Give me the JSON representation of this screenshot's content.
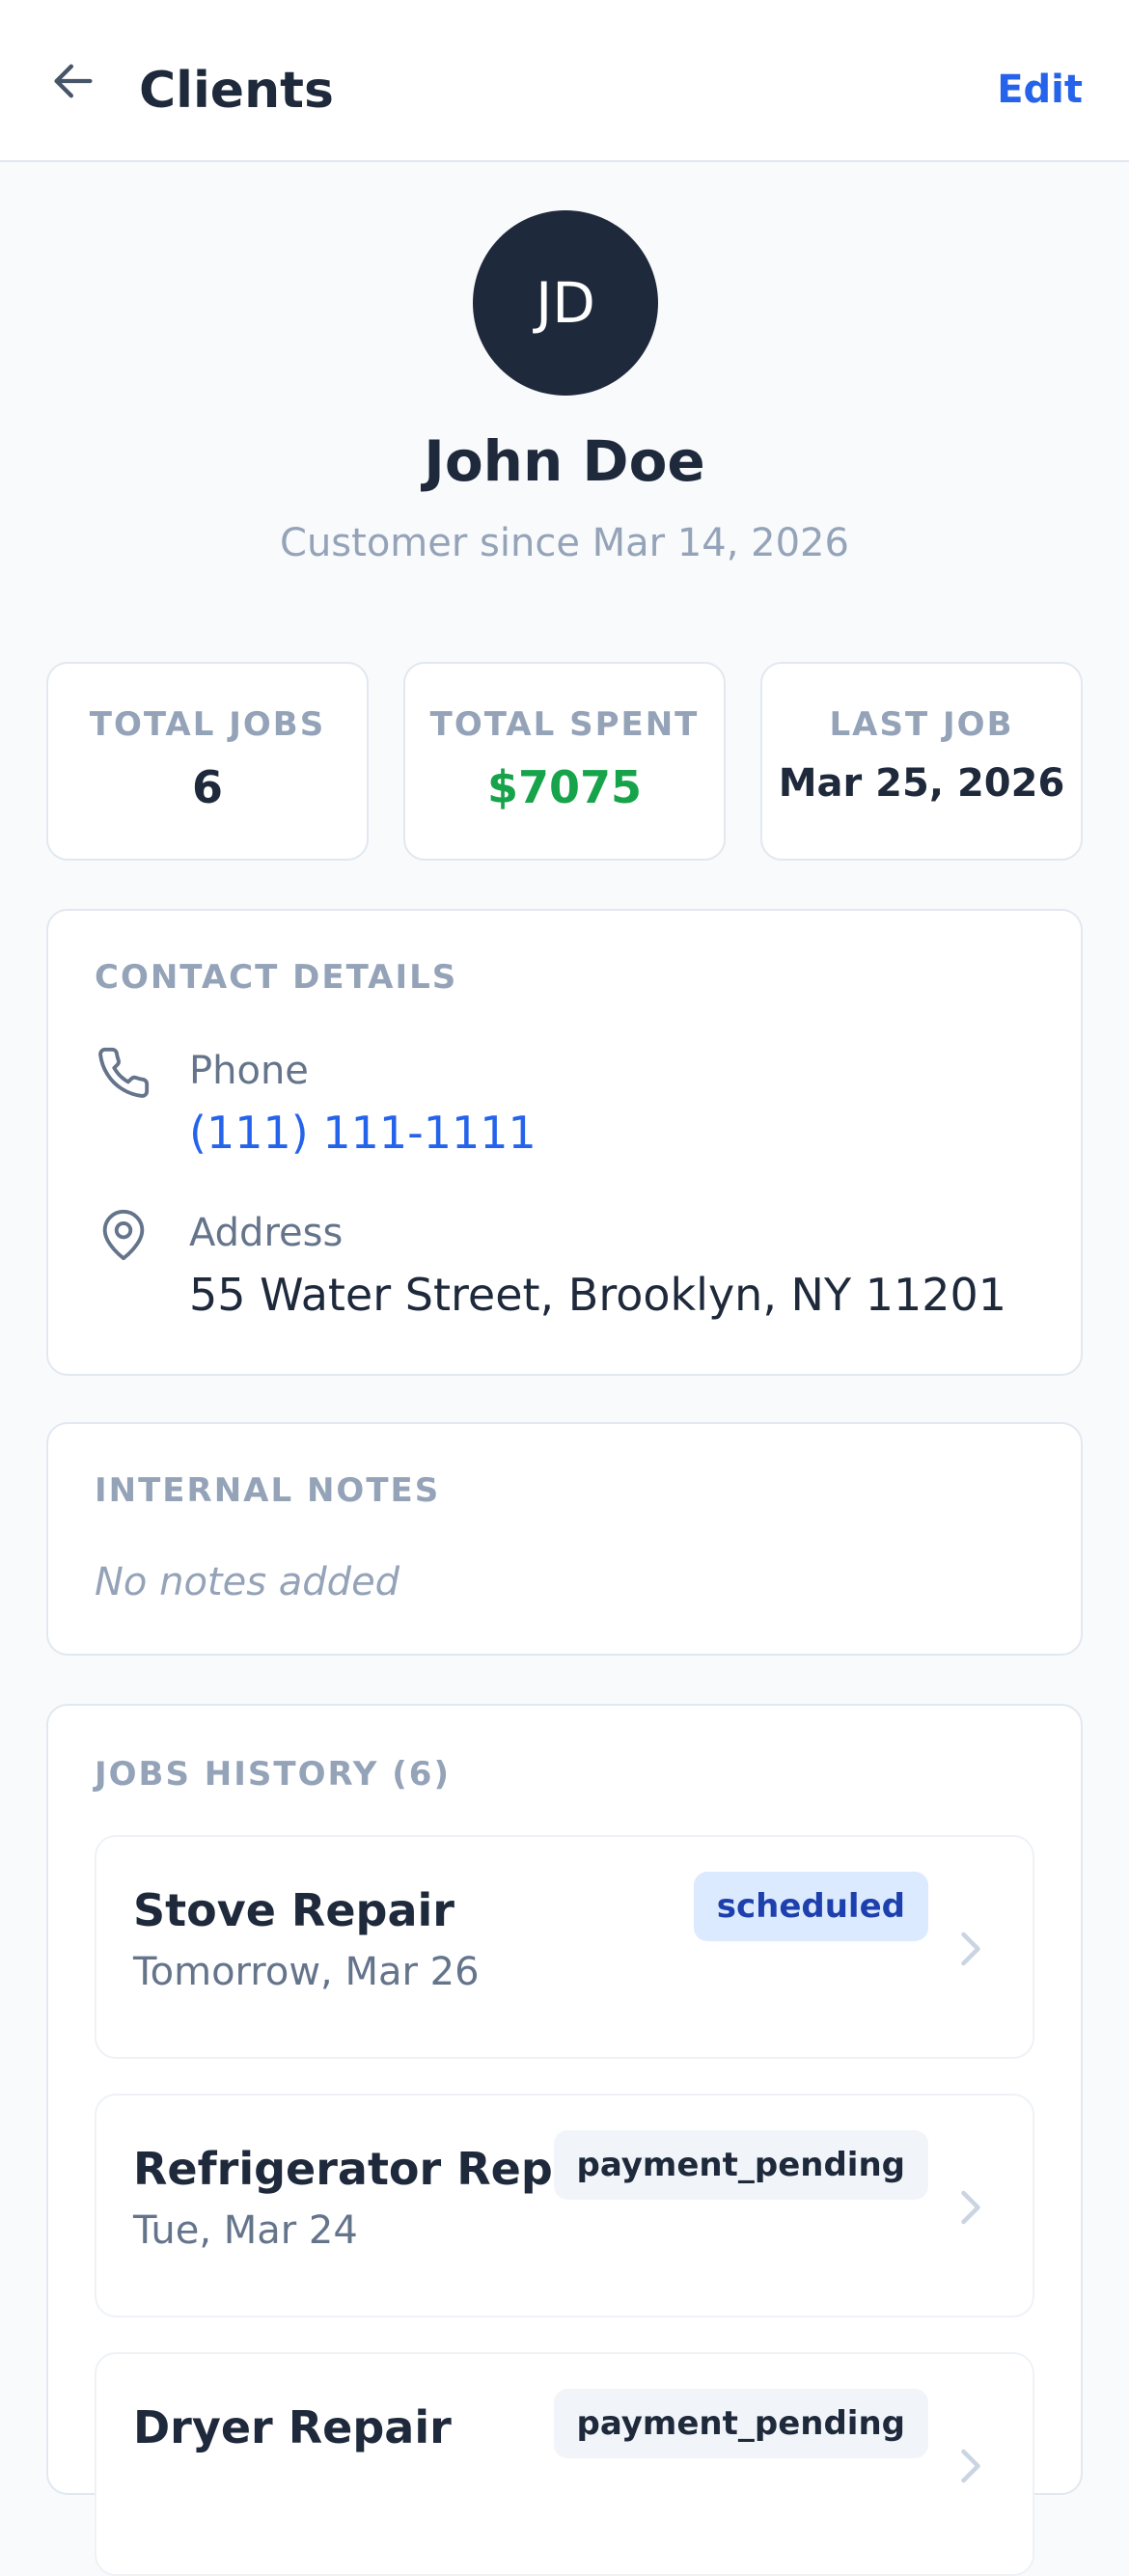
{
  "header": {
    "title": "Clients",
    "edit_label": "Edit"
  },
  "client": {
    "initials": "JD",
    "name": "John Doe",
    "since": "Customer since Mar 14, 2026"
  },
  "stats": [
    {
      "label": "TOTAL JOBS",
      "value": "6"
    },
    {
      "label": "TOTAL SPENT",
      "value": "$7075"
    },
    {
      "label": "LAST JOB",
      "value": "Mar 25, 2026"
    }
  ],
  "contact": {
    "title": "CONTACT DETAILS",
    "phone_label": "Phone",
    "phone_value": "(111) 111-1111",
    "address_label": "Address",
    "address_value": "55 Water Street, Brooklyn, NY 11201"
  },
  "notes": {
    "title": "INTERNAL NOTES",
    "empty_text": "No notes added"
  },
  "jobs": {
    "title": "JOBS HISTORY (6)",
    "items": [
      {
        "title": "Stove Repair",
        "date": "Tomorrow, Mar 26",
        "status": "scheduled"
      },
      {
        "title": "Refrigerator Repair",
        "date": "Tue, Mar 24",
        "status": "payment_pending"
      },
      {
        "title": "Dryer Repair",
        "date": "",
        "status": "payment_pending"
      }
    ]
  },
  "colors": {
    "accent": "#2563eb",
    "avatar_bg": "#1e293b",
    "spent_green": "#16a34a",
    "scheduled_badge_bg": "#dbeafe",
    "pending_badge_bg": "#f1f5f9"
  },
  "icons": {
    "back": "arrow-left-icon",
    "phone": "phone-icon",
    "address": "map-pin-icon",
    "row_chevron": "chevron-right-icon"
  }
}
